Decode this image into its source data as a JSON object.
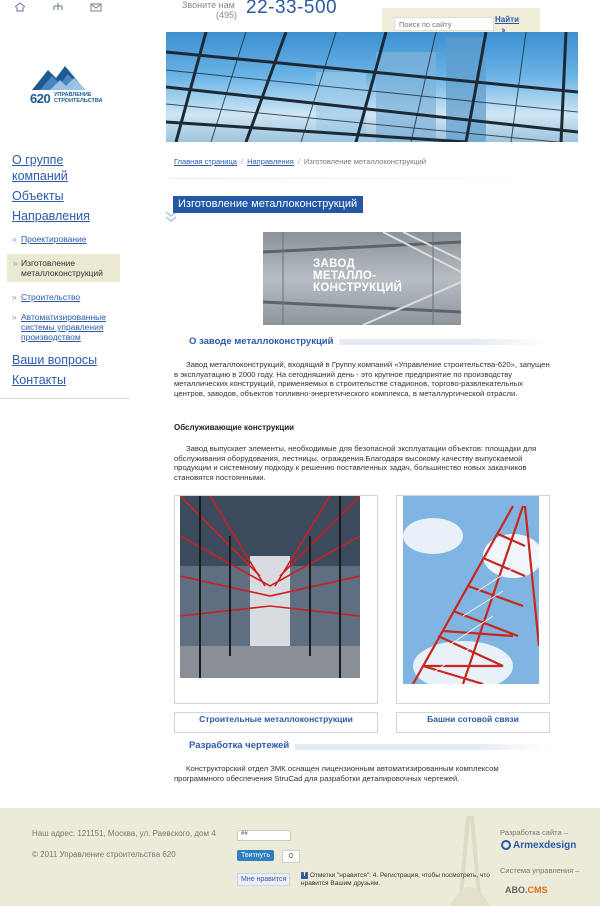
{
  "header": {
    "icons": [
      "home-icon",
      "sitemap-icon",
      "mail-icon"
    ],
    "phone_label": "Звоните нам",
    "phone_code": "(495)",
    "phone_number": "22-33-500",
    "search_placeholder": "Поиск по сайту",
    "search_button": "Найти"
  },
  "logo": {
    "number": "620",
    "line1": "УПРАВЛЕНИЕ",
    "line2": "СТРОИТЕЛЬСТВА"
  },
  "nav": {
    "items": [
      {
        "label": "О группе компаний"
      },
      {
        "label": "Объекты"
      },
      {
        "label": "Направления"
      },
      {
        "label": "Проектирование"
      },
      {
        "label": "Изготовление металлоконструкций"
      },
      {
        "label": "Строительство"
      },
      {
        "label": "Автоматизированные системы управления производством"
      },
      {
        "label": "Ваши вопросы"
      },
      {
        "label": "Контакты"
      }
    ]
  },
  "breadcrumb": [
    "Главная страница",
    "Направления",
    "Изготовление металлоконструкций"
  ],
  "main": {
    "title": "Изготовление металлоконструкций",
    "plant_text": [
      "ЗАВОД",
      "МЕТАЛЛО-",
      "КОНСТРУКЦИЙ"
    ],
    "section1_title": "О заводе металлоконструкций",
    "section1_text": "Завод металлоконструкций, входящий в Группу компаний «Управление строительства-620», запущен в эксплуатацию в 2000 году. На сегодняшний день - это крупное предприятие по производству металлических конструкций, применяемых в строительстве стадионов, торгово-развлекательных центров, заводов, объектов топливно-энергетического комплекса, в металлургической отрасли.",
    "subsection_title": "Обслуживающие конструкции",
    "subsection_text": "Завод выпускает элементы, необходимые для безопасной эксплуатации объектов: площадки для обслуживания оборудования, лестницы, ограждения.Благодаря высокому качеству выпускаемой продукции и системному подходу к решению поставленных задач, большинство новых заказчиков становятся постоянными.",
    "caption1": "Строительные металлоконструкции",
    "caption2": "Башни сотовой связи",
    "section2_title": "Разработка чертежей",
    "section2_text": "Конструкторский отдел ЗМК оснащен лицензионным автоматизированным комплексом программного обеспечения StruCad для разработки деталировочных чертежей."
  },
  "footer": {
    "address": "Наш адрес: 121151, Москва, ул. Раевского, дом 4",
    "copyright": "© 2011 Управление строительства 620",
    "counter": "##",
    "tweet_label": "Твитнуть",
    "tweet_count": "0",
    "fb_like": "Мне нравится",
    "fb_text": "Отметки \"нравится\": 4. Регистрация, чтобы посмотреть, что нравится Вашим друзьям.",
    "dev_label": "Разработка сайта –",
    "dev_name": "Armexdesign",
    "cms_label": "Система управления –",
    "cms_name_a": "ABO.",
    "cms_name_b": "CMS"
  }
}
